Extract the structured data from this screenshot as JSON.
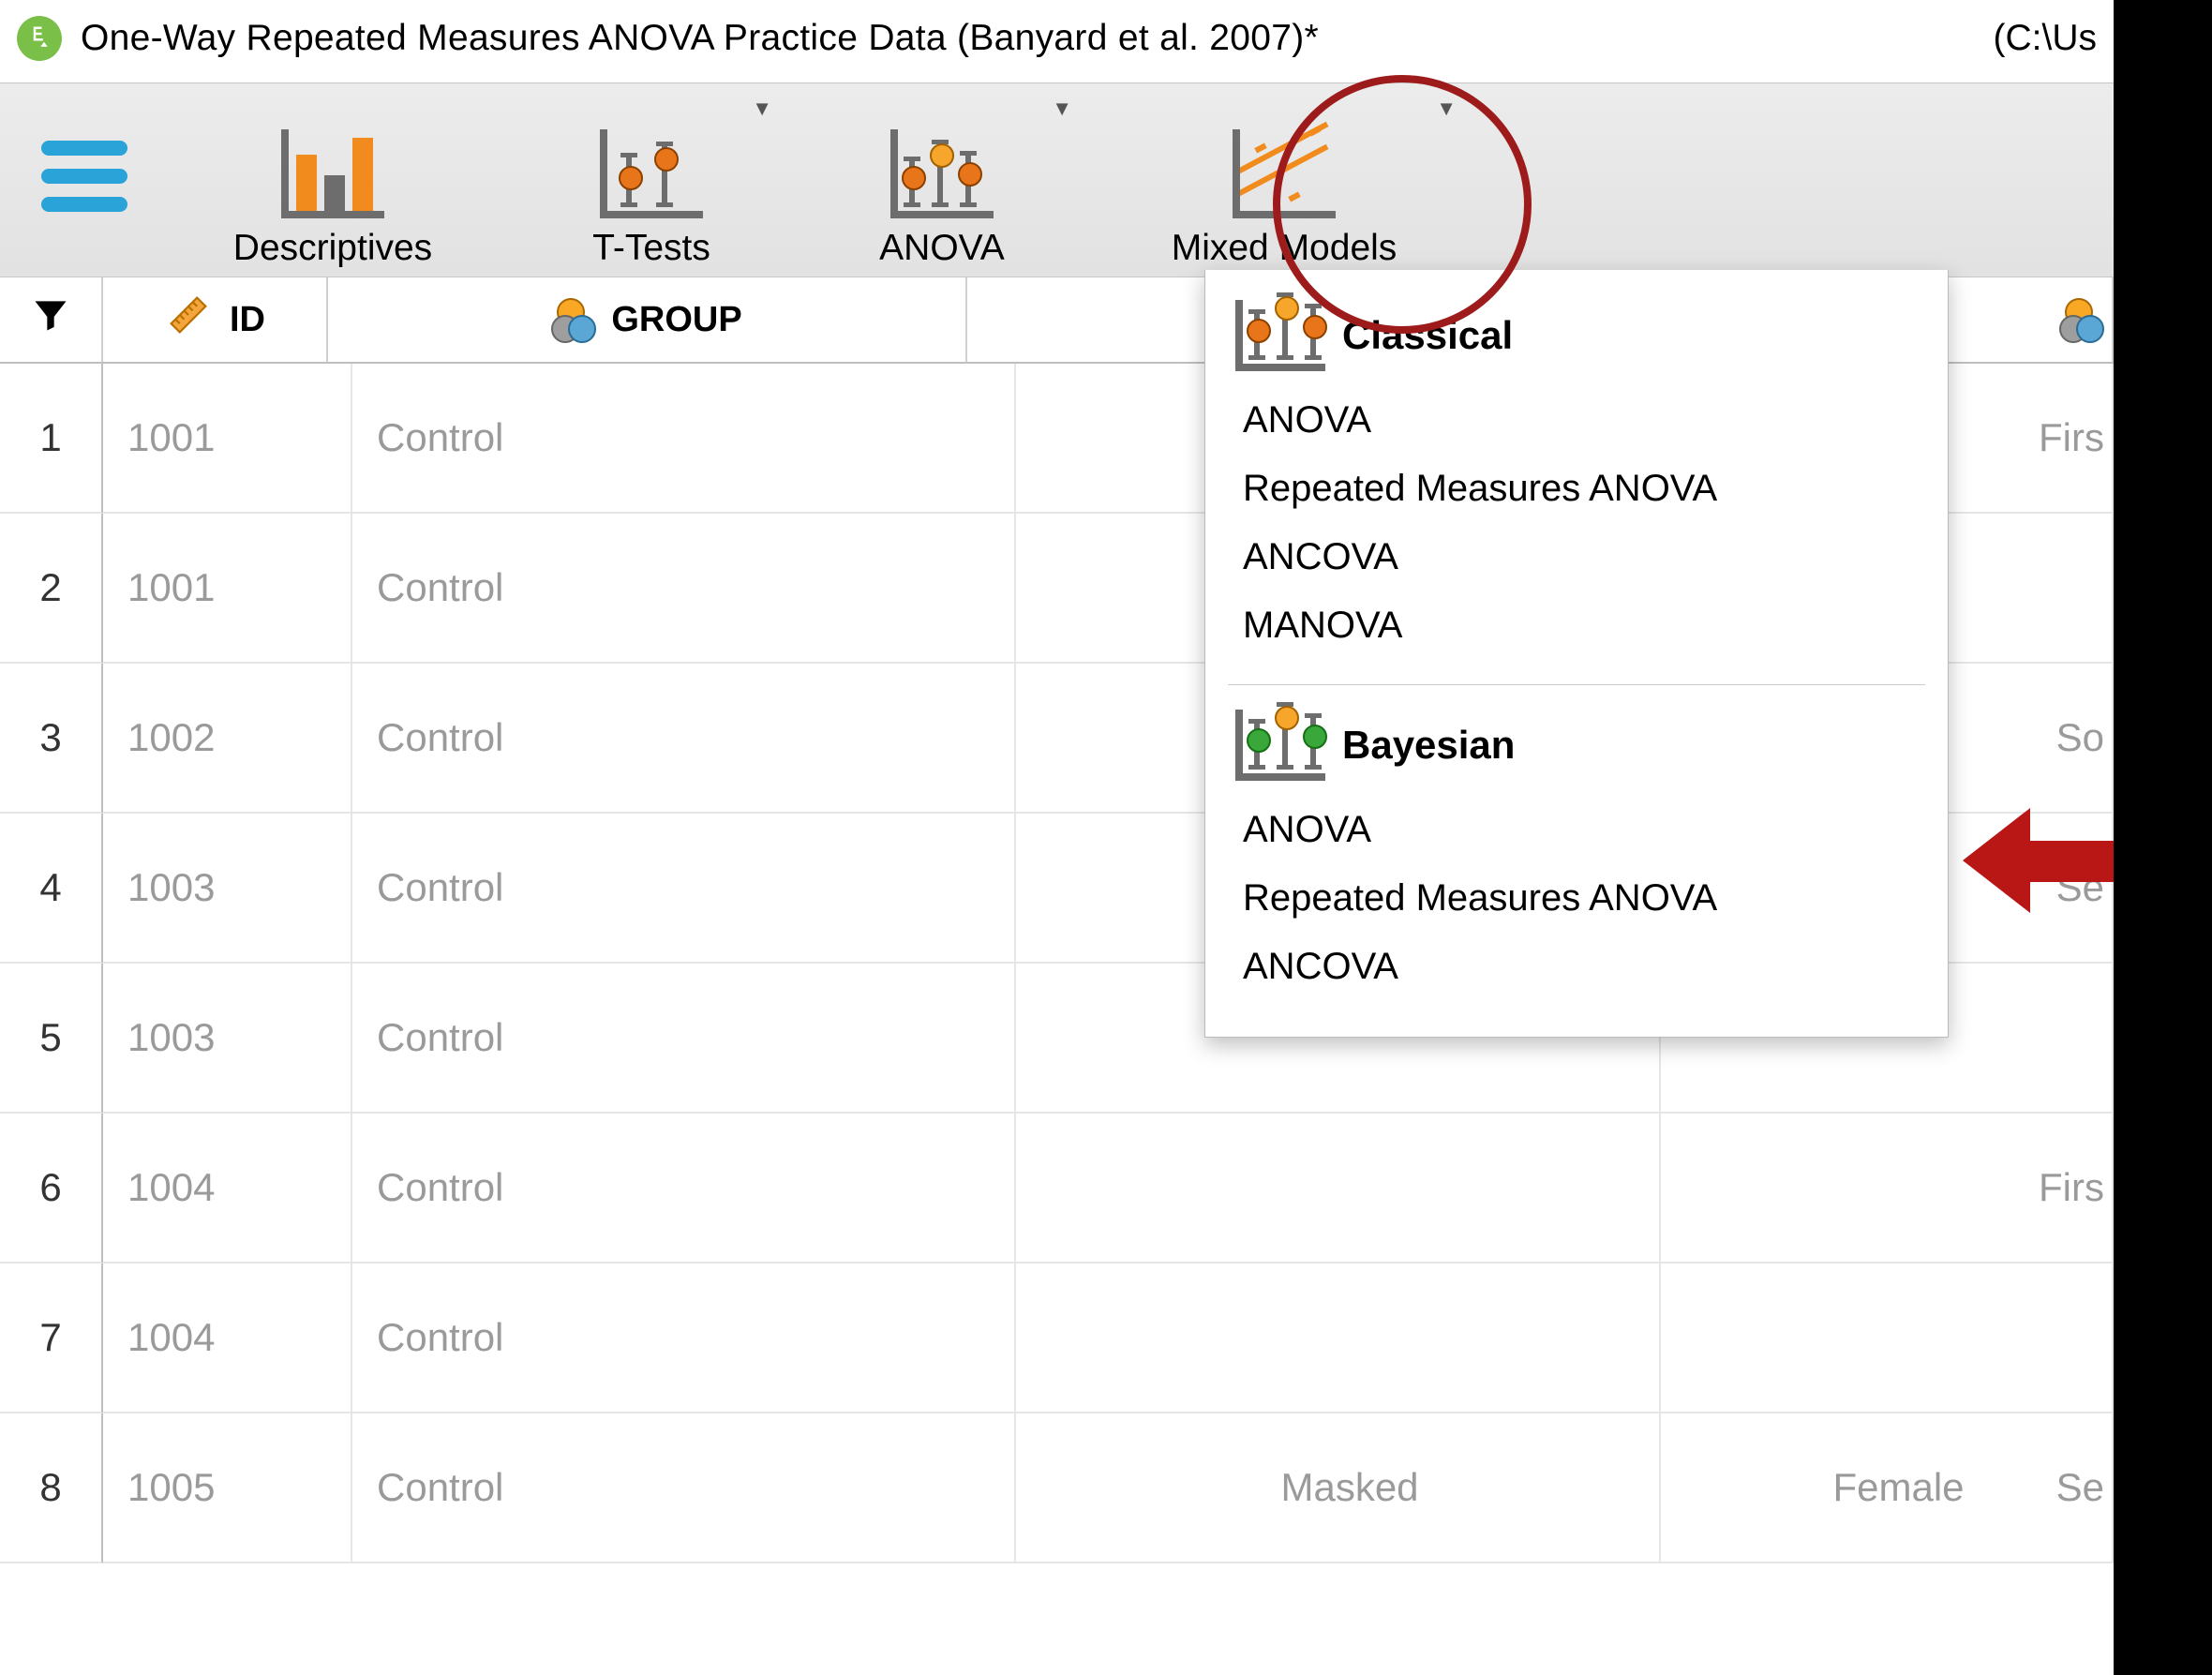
{
  "title": "One-Way Repeated Measures ANOVA Practice Data (Banyard et al. 2007)*",
  "title_path": "(C:\\Us",
  "toolbar": {
    "descriptives": "Descriptives",
    "t_tests": "T-Tests",
    "anova": "ANOVA",
    "mixed_models": "Mixed Models"
  },
  "columns": {
    "id": "ID",
    "group": "GROUP"
  },
  "rows": [
    {
      "n": "1",
      "id": "1001",
      "group": "Control",
      "peek4": "Firs"
    },
    {
      "n": "2",
      "id": "1001",
      "group": "Control",
      "peek4": ""
    },
    {
      "n": "3",
      "id": "1002",
      "group": "Control",
      "peek4": "So"
    },
    {
      "n": "4",
      "id": "1003",
      "group": "Control",
      "peek4": "Se"
    },
    {
      "n": "5",
      "id": "1003",
      "group": "Control",
      "peek4": ""
    },
    {
      "n": "6",
      "id": "1004",
      "group": "Control",
      "peek4": "Firs"
    },
    {
      "n": "7",
      "id": "1004",
      "group": "Control",
      "peek4": ""
    },
    {
      "n": "8",
      "id": "1005",
      "group": "Control",
      "peek4": "Se",
      "extra3": "Masked",
      "extra4a": "Female"
    }
  ],
  "menu": {
    "classical": {
      "title": "Classical",
      "items": [
        "ANOVA",
        "Repeated Measures ANOVA",
        "ANCOVA",
        "MANOVA"
      ]
    },
    "bayesian": {
      "title": "Bayesian",
      "items": [
        "ANOVA",
        "Repeated Measures ANOVA",
        "ANCOVA"
      ]
    }
  }
}
